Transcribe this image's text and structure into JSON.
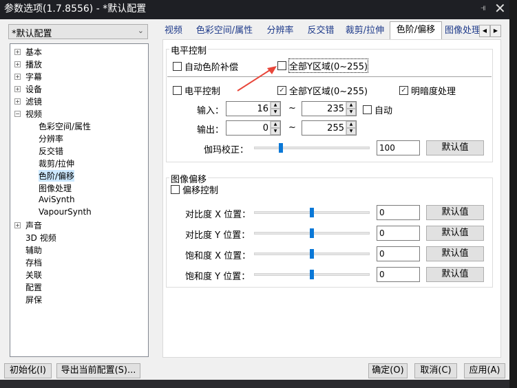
{
  "window": {
    "title": "参数选项(1.7.8556) - *默认配置",
    "pin_icon": "pin-icon",
    "close_icon": "close-icon"
  },
  "profile": {
    "selected": "*默认配置"
  },
  "tree": [
    {
      "label": "基本",
      "level": 0,
      "expander": "+"
    },
    {
      "label": "播放",
      "level": 0,
      "expander": "+"
    },
    {
      "label": "字幕",
      "level": 0,
      "expander": "+"
    },
    {
      "label": "设备",
      "level": 0,
      "expander": "+"
    },
    {
      "label": "滤镜",
      "level": 0,
      "expander": "+"
    },
    {
      "label": "视频",
      "level": 0,
      "expander": "-"
    },
    {
      "label": "色彩空间/属性",
      "level": 1
    },
    {
      "label": "分辨率",
      "level": 1
    },
    {
      "label": "反交错",
      "level": 1
    },
    {
      "label": "裁剪/拉伸",
      "level": 1
    },
    {
      "label": "色阶/偏移",
      "level": 1,
      "selected": true
    },
    {
      "label": "图像处理",
      "level": 1
    },
    {
      "label": "AviSynth",
      "level": 1
    },
    {
      "label": "VapourSynth",
      "level": 1
    },
    {
      "label": "声音",
      "level": 0,
      "expander": "+"
    },
    {
      "label": "3D 视频",
      "level": 0
    },
    {
      "label": "辅助",
      "level": 0
    },
    {
      "label": "存档",
      "level": 0
    },
    {
      "label": "关联",
      "level": 0
    },
    {
      "label": "配置",
      "level": 0
    },
    {
      "label": "屏保",
      "level": 0
    }
  ],
  "tabs": [
    "视频",
    "色彩空间/属性",
    "分辨率",
    "反交错",
    "裁剪/拉伸",
    "色阶/偏移",
    "图像处理"
  ],
  "active_tab": "色阶/偏移",
  "level": {
    "title": "电平控制",
    "auto_levels": {
      "label": "自动色阶补偿",
      "checked": false
    },
    "full_y_top": {
      "label": "全部Y区域(0~255)",
      "checked": false
    },
    "level_control": {
      "label": "电平控制",
      "checked": false
    },
    "full_y": {
      "label": "全部Y区域(0~255)",
      "checked": true
    },
    "brightness": {
      "label": "明暗度处理",
      "checked": true
    },
    "input_label": "输入：",
    "input_min": "16",
    "input_max": "235",
    "tilde": "~",
    "auto": {
      "label": "自动",
      "checked": false
    },
    "output_label": "输出：",
    "output_min": "0",
    "output_max": "255",
    "gamma_label": "伽玛校正：",
    "gamma_value": "100",
    "gamma_slider_fraction": 0.23,
    "default_label": "默认值"
  },
  "offset": {
    "title": "图像偏移",
    "offset_control": {
      "label": "偏移控制",
      "checked": false
    },
    "rows": [
      {
        "label": "对比度 X 位置：",
        "value": "0",
        "slider_fraction": 0.5,
        "button": "默认值"
      },
      {
        "label": "对比度 Y 位置：",
        "value": "0",
        "slider_fraction": 0.5,
        "button": "默认值"
      },
      {
        "label": "饱和度 X 位置：",
        "value": "0",
        "slider_fraction": 0.5,
        "button": "默认值"
      },
      {
        "label": "饱和度 Y 位置：",
        "value": "0",
        "slider_fraction": 0.5,
        "button": "默认值"
      }
    ]
  },
  "footer": {
    "init": "初始化(I)",
    "export": "导出当前配置(S)...",
    "ok": "确定(O)",
    "cancel": "取消(C)",
    "apply": "应用(A)"
  },
  "colors": {
    "accent": "#0a78d7",
    "titlebar": "#1e1f24",
    "arrow": "#e8463a"
  }
}
